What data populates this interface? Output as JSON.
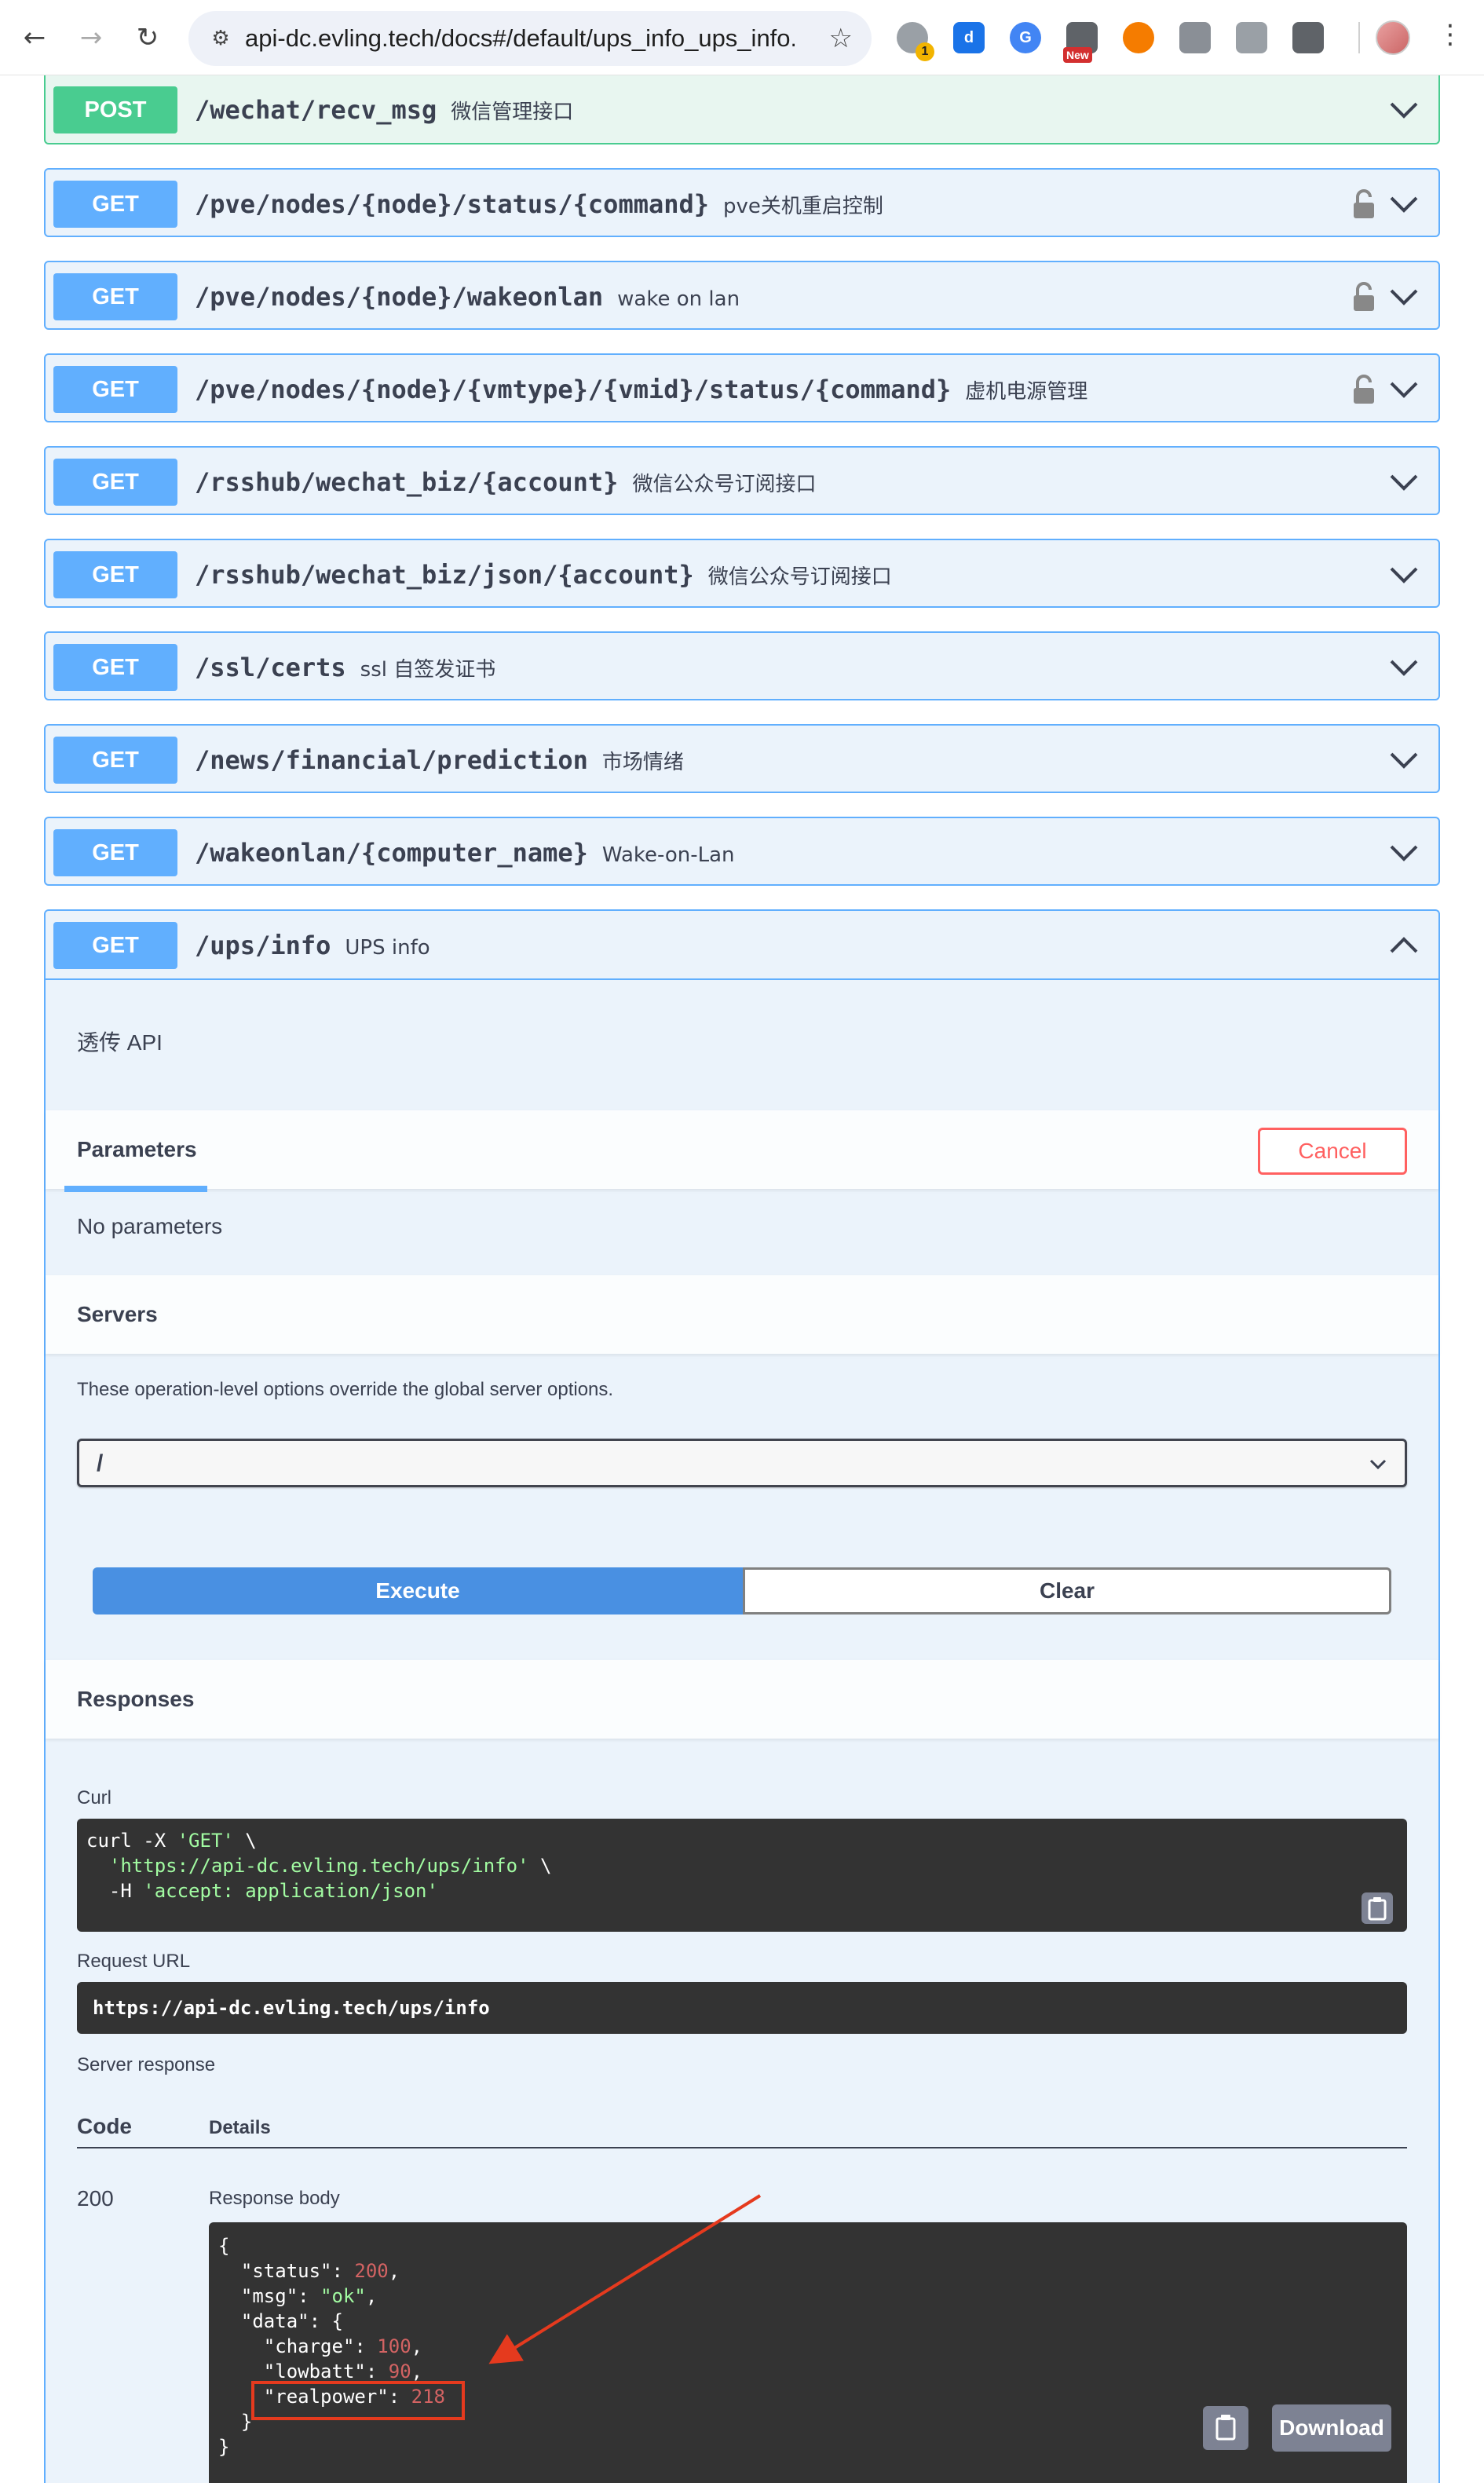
{
  "browser": {
    "url": "api-dc.evling.tech/docs#/default/ups_info_ups_info...",
    "nav_back": "←",
    "nav_forward": "→",
    "nav_reload": "↻",
    "site_info_icon": "⚙",
    "bookmark_star": "☆",
    "extension_badge_count": "1",
    "extension_new_badge": "New",
    "menu": "⋮"
  },
  "operations": [
    {
      "method": "POST",
      "path": "/wechat/recv_msg",
      "summary": "微信管理接口",
      "locked": false
    },
    {
      "method": "GET",
      "path": "/pve/nodes/{node}/status/{command}",
      "summary": "pve关机重启控制",
      "locked": true
    },
    {
      "method": "GET",
      "path": "/pve/nodes/{node}/wakeonlan",
      "summary": "wake on lan",
      "locked": true
    },
    {
      "method": "GET",
      "path": "/pve/nodes/{node}/{vmtype}/{vmid}/status/{command}",
      "summary": "虚机电源管理",
      "locked": true
    },
    {
      "method": "GET",
      "path": "/rsshub/wechat_biz/{account}",
      "summary": "微信公众号订阅接口",
      "locked": false
    },
    {
      "method": "GET",
      "path": "/rsshub/wechat_biz/json/{account}",
      "summary": "微信公众号订阅接口",
      "locked": false
    },
    {
      "method": "GET",
      "path": "/ssl/certs",
      "summary": "ssl 自签发证书",
      "locked": false
    },
    {
      "method": "GET",
      "path": "/news/financial/prediction",
      "summary": "市场情绪",
      "locked": false
    },
    {
      "method": "GET",
      "path": "/wakeonlan/{computer_name}",
      "summary": "Wake-on-Lan",
      "locked": false
    }
  ],
  "expanded": {
    "method": "GET",
    "path": "/ups/info",
    "summary": "UPS info",
    "description": "透传 API",
    "parameters_title": "Parameters",
    "cancel_label": "Cancel",
    "no_parameters": "No parameters",
    "servers_title": "Servers",
    "servers_note": "These operation-level options override the global server options.",
    "server_selected": "/",
    "execute_label": "Execute",
    "clear_label": "Clear",
    "responses_title": "Responses",
    "curl_label": "Curl",
    "curl_line1_cmd": "curl -X ",
    "curl_line1_method": "'GET'",
    "curl_line1_tail": " \\",
    "curl_line2_url": "'https://api-dc.evling.tech/ups/info'",
    "curl_line2_tail": " \\",
    "curl_line3_flag": "  -H ",
    "curl_line3_header": "'accept: application/json'",
    "request_url_label": "Request URL",
    "request_url": "https://api-dc.evling.tech/ups/info",
    "server_response_label": "Server response",
    "code_header": "Code",
    "details_header": "Details",
    "status_code": "200",
    "response_body_label": "Response body",
    "download_label": "Download",
    "body": {
      "status_key": "\"status\"",
      "status_val": "200",
      "msg_key": "\"msg\"",
      "msg_val": "\"ok\"",
      "data_key": "\"data\"",
      "charge_key": "\"charge\"",
      "charge_val": "100",
      "lowbatt_key": "\"lowbatt\"",
      "lowbatt_val": "90",
      "realpower_key": "\"realpower\"",
      "realpower_val": "218"
    }
  },
  "colors": {
    "get": "#61affe",
    "post": "#49cc90",
    "cancel": "#ff6060",
    "execute": "#4990e2",
    "annotation": "#e53a1e"
  }
}
